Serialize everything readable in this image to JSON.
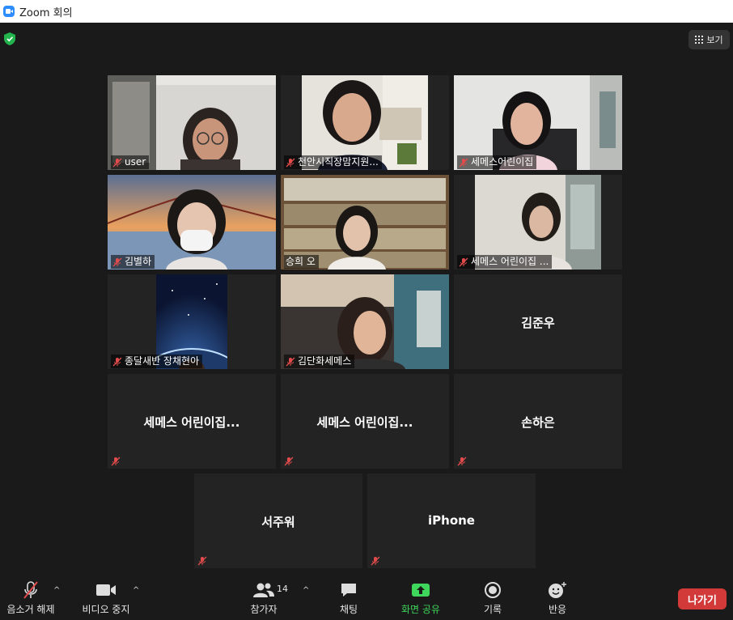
{
  "window": {
    "title": "Zoom 회의"
  },
  "view_button": {
    "label": "보기"
  },
  "participants": [
    {
      "name": "user",
      "video": true,
      "muted": true,
      "active": false
    },
    {
      "name": "천안시직장맘지원...",
      "video": true,
      "muted": true,
      "active": false
    },
    {
      "name": "세메스어린이집",
      "video": true,
      "muted": true,
      "active": false
    },
    {
      "name": "김별하",
      "video": true,
      "muted": false,
      "active": false
    },
    {
      "name": "승희 오",
      "video": true,
      "muted": false,
      "active": true
    },
    {
      "name": "세메스 어린이집 ...",
      "video": true,
      "muted": true,
      "active": false
    },
    {
      "name": "종달새반 장채현아",
      "video": true,
      "muted": true,
      "active": false
    },
    {
      "name": "김단화세메스",
      "video": true,
      "muted": true,
      "active": false
    },
    {
      "name": "김준우",
      "video": false,
      "muted": false,
      "active": false
    },
    {
      "name": "세메스 어린이집...",
      "video": false,
      "muted": true,
      "active": false
    },
    {
      "name": "세메스 어린이집...",
      "video": false,
      "muted": true,
      "active": false
    },
    {
      "name": "손하은",
      "video": false,
      "muted": true,
      "active": false
    },
    {
      "name": "서주워",
      "video": false,
      "muted": true,
      "active": false
    },
    {
      "name": "iPhone",
      "video": false,
      "muted": true,
      "active": false
    }
  ],
  "toolbar": {
    "mute": "음소거 해제",
    "video": "비디오 중지",
    "participants": "참가자",
    "participant_count": "14",
    "chat": "채팅",
    "share": "화면 공유",
    "record": "기록",
    "reactions": "반응",
    "leave": "나가기"
  },
  "colors": {
    "share_green": "#3ed65b",
    "leave_red": "#d23a3a",
    "active_speaker": "#d9eb5a",
    "mute_red": "#e24b4b"
  }
}
